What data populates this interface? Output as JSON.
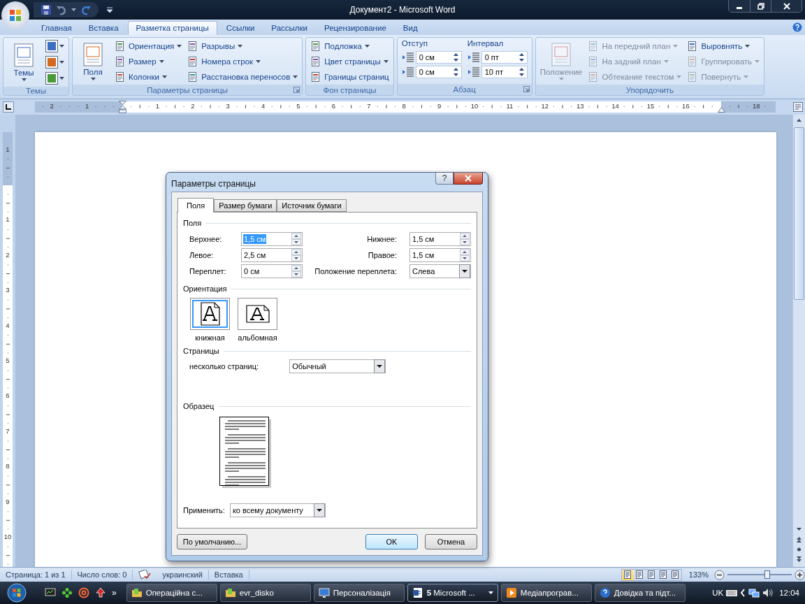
{
  "window": {
    "title": "Документ2 - Microsoft Word"
  },
  "ribbon_tabs": [
    {
      "label": "Главная",
      "selected": false
    },
    {
      "label": "Вставка",
      "selected": false
    },
    {
      "label": "Разметка страницы",
      "selected": true
    },
    {
      "label": "Ссылки",
      "selected": false
    },
    {
      "label": "Рассылки",
      "selected": false
    },
    {
      "label": "Рецензирование",
      "selected": false
    },
    {
      "label": "Вид",
      "selected": false
    }
  ],
  "ribbon_groups": [
    {
      "title": "Темы",
      "launcher": false,
      "columns": [
        [
          {
            "kind": "large",
            "label": "Темы",
            "dropdown": true,
            "disabled": false
          }
        ],
        [
          {
            "kind": "icon",
            "dropdown": true,
            "disabled": false
          },
          {
            "kind": "icon",
            "dropdown": true,
            "disabled": false
          },
          {
            "kind": "icon",
            "dropdown": true,
            "disabled": false
          }
        ]
      ]
    },
    {
      "title": "Параметры страницы",
      "launcher": true,
      "columns": [
        [
          {
            "kind": "large",
            "label": "Поля",
            "dropdown": true,
            "disabled": false
          }
        ],
        [
          {
            "kind": "small",
            "label": "Ориентация",
            "dropdown": true,
            "disabled": false
          },
          {
            "kind": "small",
            "label": "Размер",
            "dropdown": true,
            "disabled": false
          },
          {
            "kind": "small",
            "label": "Колонки",
            "dropdown": true,
            "disabled": false
          }
        ],
        [
          {
            "kind": "small",
            "label": "Разрывы",
            "dropdown": true,
            "disabled": false
          },
          {
            "kind": "small",
            "label": "Номера строк",
            "dropdown": true,
            "disabled": false
          },
          {
            "kind": "small",
            "label": "Расстановка переносов",
            "dropdown": true,
            "disabled": false
          }
        ]
      ]
    },
    {
      "title": "Фон страницы",
      "launcher": false,
      "columns": [
        [
          {
            "kind": "small",
            "label": "Подложка",
            "dropdown": true,
            "disabled": false
          },
          {
            "kind": "small",
            "label": "Цвет страницы",
            "dropdown": true,
            "disabled": false
          },
          {
            "kind": "small",
            "label": "Границы страниц",
            "dropdown": false,
            "disabled": false
          }
        ]
      ]
    },
    {
      "title": "Абзац",
      "launcher": true,
      "columns": [
        [
          {
            "kind": "heading",
            "label": "Отступ"
          },
          {
            "kind": "spin",
            "value": "0 см"
          },
          {
            "kind": "spin",
            "value": "0 см"
          }
        ],
        [
          {
            "kind": "heading",
            "label": "Интервал"
          },
          {
            "kind": "spin",
            "value": "0 пт"
          },
          {
            "kind": "spin",
            "value": "10 пт"
          }
        ]
      ]
    },
    {
      "title": "Упорядочить",
      "launcher": false,
      "columns": [
        [
          {
            "kind": "large",
            "label": "Положение",
            "dropdown": true,
            "disabled": true
          }
        ],
        [
          {
            "kind": "small",
            "label": "На передний план",
            "dropdown": true,
            "disabled": true
          },
          {
            "kind": "small",
            "label": "На задний план",
            "dropdown": true,
            "disabled": true
          },
          {
            "kind": "small",
            "label": "Обтекание текстом",
            "dropdown": true,
            "disabled": true
          }
        ],
        [
          {
            "kind": "small",
            "label": "Выровнять",
            "dropdown": true,
            "disabled": false
          },
          {
            "kind": "small",
            "label": "Группировать",
            "dropdown": true,
            "disabled": true
          },
          {
            "kind": "small",
            "label": "Повернуть",
            "dropdown": true,
            "disabled": true
          }
        ]
      ]
    }
  ],
  "ruler": {
    "labels": [
      "2",
      "1",
      "1",
      "2",
      "3",
      "4",
      "5",
      "6",
      "7",
      "8",
      "9",
      "10",
      "11",
      "12",
      "13",
      "14",
      "15",
      "16",
      "18"
    ]
  },
  "vertical_ruler": {
    "labels": [
      "1",
      "1",
      "2",
      "3",
      "4",
      "5",
      "6",
      "7",
      "8",
      "9",
      "10"
    ]
  },
  "dialog": {
    "title": "Параметры страницы",
    "help": "?",
    "tabs": [
      {
        "label": "Поля",
        "selected": true
      },
      {
        "label": "Размер бумаги",
        "selected": false
      },
      {
        "label": "Источник бумаги",
        "selected": false
      }
    ],
    "margins": {
      "heading": "Поля",
      "fields": [
        {
          "label": "Верхнее:",
          "value": "1,5 см",
          "kind": "spin",
          "highlighted": true
        },
        {
          "label": "Нижнее:",
          "value": "1,5 см",
          "kind": "spin",
          "highlighted": false
        },
        {
          "label": "Левое:",
          "value": "2,5 см",
          "kind": "spin",
          "highlighted": false
        },
        {
          "label": "Правое:",
          "value": "1,5 см",
          "kind": "spin",
          "highlighted": false
        },
        {
          "label": "Переплет:",
          "value": "0 см",
          "kind": "spin",
          "highlighted": false
        },
        {
          "label": "Положение переплета:",
          "value": "Слева",
          "kind": "dropdown",
          "highlighted": false
        }
      ]
    },
    "orientation": {
      "heading": "Ориентация",
      "options": [
        {
          "label": "книжная",
          "kind": "portrait",
          "selected": true
        },
        {
          "label": "альбомная",
          "kind": "landscape",
          "selected": false
        }
      ]
    },
    "pages": {
      "heading": "Страницы",
      "label": "несколько страниц:",
      "value": "Обычный"
    },
    "preview": {
      "heading": "Образец"
    },
    "apply": {
      "label": "Применить:",
      "value": "ко всему документу"
    },
    "buttons": [
      {
        "label": "По умолчанию...",
        "kind": "left"
      },
      {
        "label": "OK",
        "kind": "default"
      },
      {
        "label": "Отмена",
        "kind": "normal"
      }
    ]
  },
  "status_bar": {
    "items": [
      "Страница: 1 из 1",
      "Число слов: 0",
      "украинский",
      "Вставка"
    ],
    "view_buttons": [
      {
        "selected": true
      },
      {
        "selected": false
      },
      {
        "selected": false
      },
      {
        "selected": false
      },
      {
        "selected": false
      }
    ],
    "zoom": "133%",
    "zoom_level": {
      "level": 0.62
    }
  },
  "taskbar": {
    "overflow": "»",
    "tasks": [
      {
        "label": "Операційна с...",
        "active": false,
        "kind": "folder"
      },
      {
        "label": "evr_disko",
        "active": false,
        "kind": "folder"
      },
      {
        "label": "Персоналізація",
        "active": false,
        "kind": "monitor"
      },
      {
        "label": "**5** Microsoft ...",
        "active": true,
        "kind": "word"
      },
      {
        "label": "Медіапрограв...",
        "active": false,
        "kind": "media"
      },
      {
        "label": "Довідка та підт...",
        "active": false,
        "kind": "help"
      }
    ],
    "language": "UK",
    "clock": "12:04"
  }
}
